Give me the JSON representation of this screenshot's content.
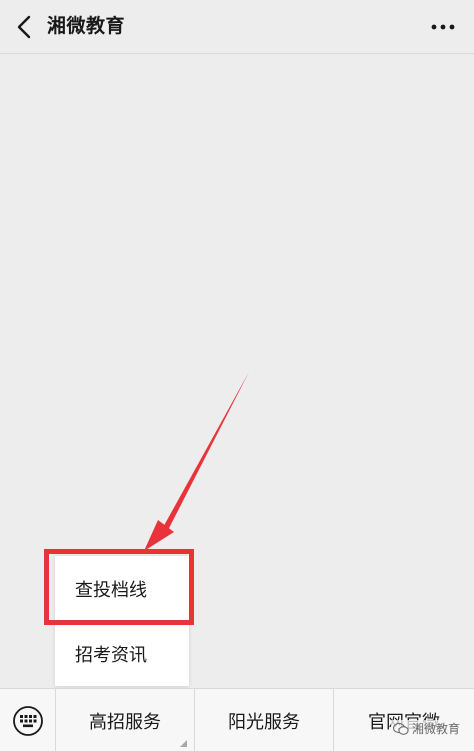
{
  "header": {
    "title": "湘微教育",
    "back_icon": "chevron-left-icon",
    "more_icon": "more-horizontal-icon"
  },
  "popup_menu": {
    "items": [
      {
        "label": "查投档线",
        "highlighted": true
      },
      {
        "label": "招考资讯",
        "highlighted": false
      }
    ]
  },
  "bottom_menu": {
    "keyboard_icon": "keyboard-icon",
    "tabs": [
      {
        "label": "高招服务"
      },
      {
        "label": "阳光服务"
      },
      {
        "label": "官网官微"
      }
    ]
  },
  "watermark": {
    "text": "湘微教育",
    "icon": "wechat-icon"
  },
  "colors": {
    "background": "#ededed",
    "highlight": "#e8333a",
    "text": "#191919"
  }
}
